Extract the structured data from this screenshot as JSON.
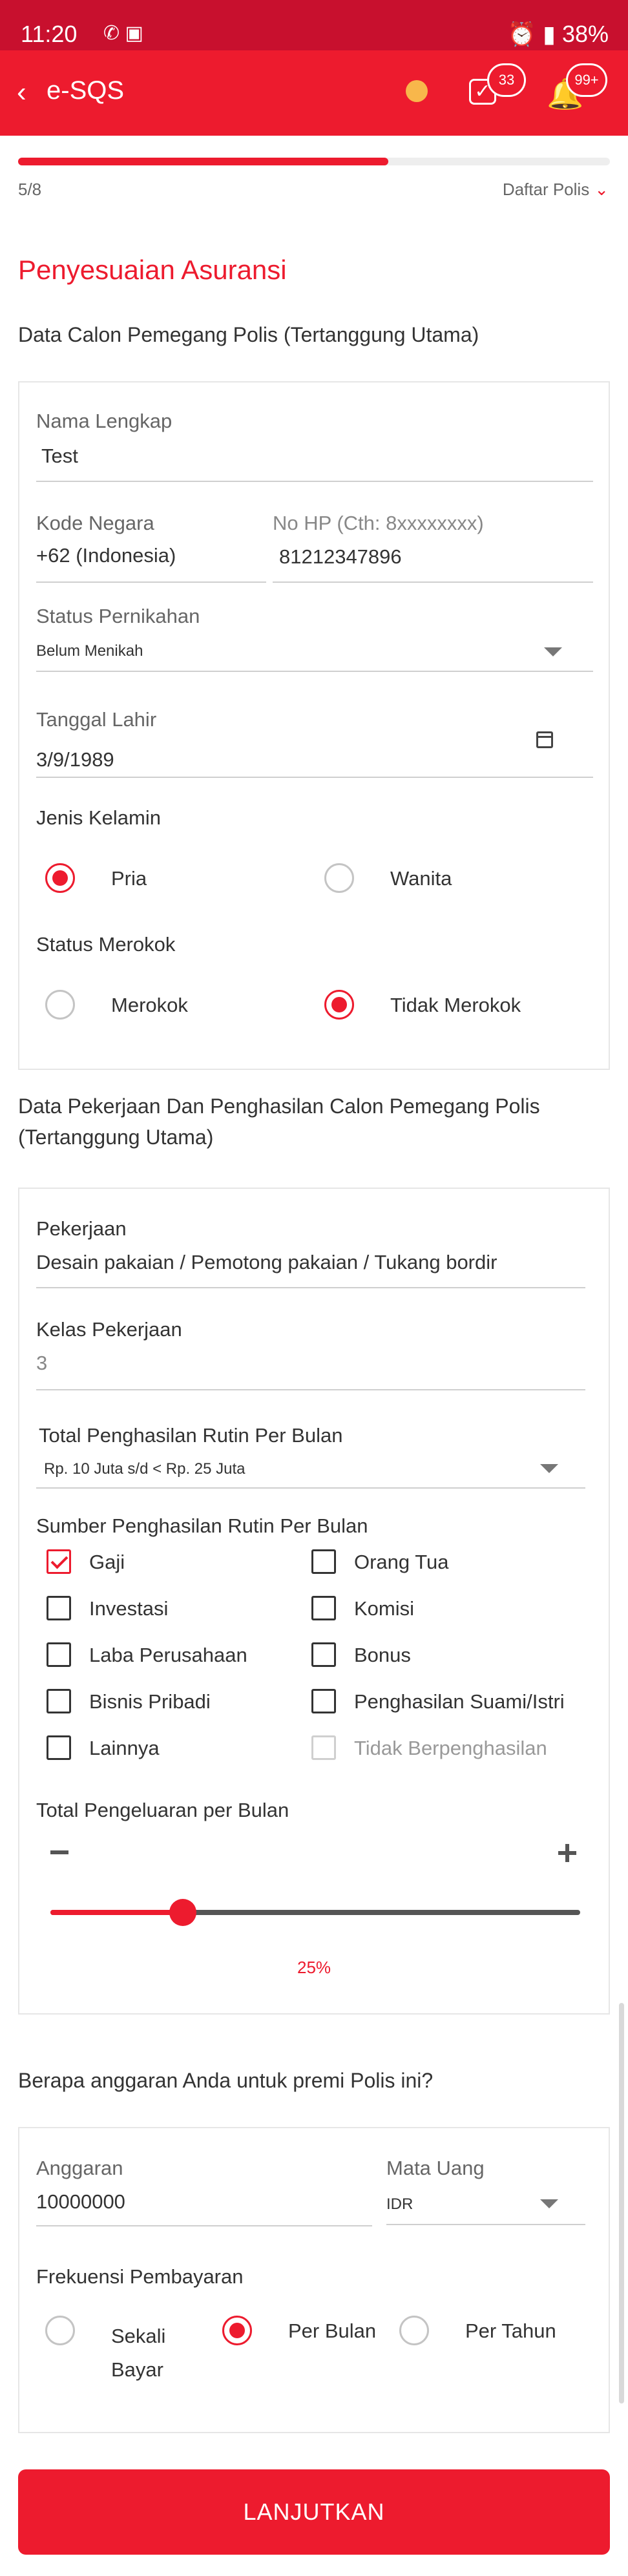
{
  "status_bar": {
    "time": "11:20",
    "battery": "38%"
  },
  "app_bar": {
    "title": "e-SQS",
    "task_badge": "33",
    "notif_badge": "99+"
  },
  "progress": {
    "step": "5/8",
    "fraction": 0.625,
    "menu_label": "Daftar Polis"
  },
  "section_title": "Penyesuaian Asuransi",
  "policyholder": {
    "heading": "Data Calon Pemegang Polis (Tertanggung Utama)",
    "name_label": "Nama Lengkap",
    "name_value": "Test",
    "country_code_label": "Kode Negara",
    "country_code_value": "+62 (Indonesia)",
    "phone_label": "No HP (Cth: 8xxxxxxxx)",
    "phone_value": "81212347896",
    "marital_label": "Status Pernikahan",
    "marital_value": "Belum Menikah",
    "dob_label": "Tanggal Lahir",
    "dob_value": "3/9/1989",
    "gender_label": "Jenis Kelamin",
    "gender_options": [
      "Pria",
      "Wanita"
    ],
    "gender_selected": "Pria",
    "smoking_label": "Status Merokok",
    "smoking_options": [
      "Merokok",
      "Tidak Merokok"
    ],
    "smoking_selected": "Tidak Merokok"
  },
  "employment": {
    "heading_line1": "Data Pekerjaan Dan Penghasilan Calon Pemegang Polis",
    "heading_line2": "(Tertanggung Utama)",
    "job_label": "Pekerjaan",
    "job_value": "Desain pakaian / Pemotong pakaian / Tukang bordir",
    "class_label": "Kelas Pekerjaan",
    "class_value": "3",
    "income_label": "Total Penghasilan Rutin Per Bulan",
    "income_value": "Rp. 10 Juta s/d < Rp. 25 Juta",
    "source_label": "Sumber Penghasilan Rutin Per Bulan",
    "sources": [
      {
        "label": "Gaji",
        "checked": true,
        "disabled": false
      },
      {
        "label": "Orang Tua",
        "checked": false,
        "disabled": false
      },
      {
        "label": "Investasi",
        "checked": false,
        "disabled": false
      },
      {
        "label": "Komisi",
        "checked": false,
        "disabled": false
      },
      {
        "label": "Laba Perusahaan",
        "checked": false,
        "disabled": false
      },
      {
        "label": "Bonus",
        "checked": false,
        "disabled": false
      },
      {
        "label": "Bisnis Pribadi",
        "checked": false,
        "disabled": false
      },
      {
        "label": "Penghasilan Suami/Istri",
        "checked": false,
        "disabled": false
      },
      {
        "label": "Lainnya",
        "checked": false,
        "disabled": false
      },
      {
        "label": "Tidak Berpenghasilan",
        "checked": false,
        "disabled": true
      }
    ],
    "expense_label": "Total Pengeluaran per Bulan",
    "expense_percent": 25,
    "expense_percent_text": "25%"
  },
  "budget": {
    "question": "Berapa anggaran Anda untuk premi Polis ini?",
    "amount_label": "Anggaran",
    "amount_value": "10000000",
    "currency_label": "Mata Uang",
    "currency_value": "IDR",
    "frequency_label": "Frekuensi Pembayaran",
    "frequency_options": [
      "Sekali",
      "Bayar",
      "Per Bulan",
      "Per Tahun"
    ],
    "frequency_selected": "Per Bulan"
  },
  "submit_label": "LANJUTKAN",
  "colors": {
    "brand": "#ed1b2e",
    "status_bar": "#c8102e"
  }
}
